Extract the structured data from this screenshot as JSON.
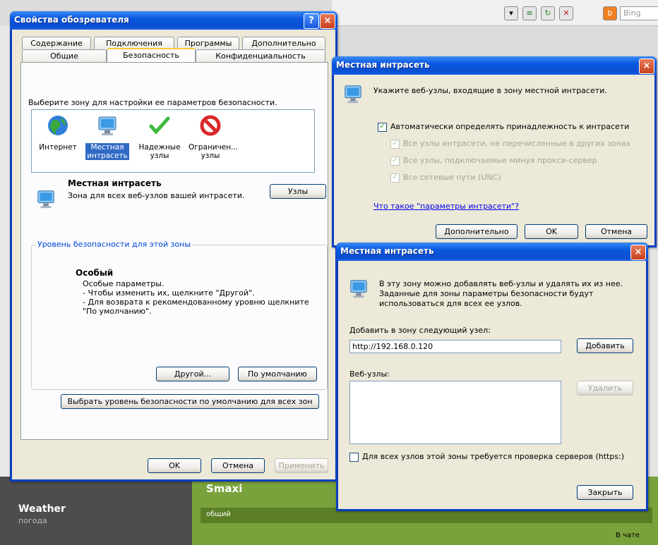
{
  "background": {
    "search_engine": "Bing",
    "weather_title": "Weather",
    "weather_sub": "погода",
    "smaxi": "Smaxi",
    "tab_general": "общий",
    "chat": "В чате"
  },
  "ie_options": {
    "title": "Свойства обозревателя",
    "help": "?",
    "close": "×",
    "tabs_row1": [
      "Содержание",
      "Подключения",
      "Программы",
      "Дополнительно"
    ],
    "tabs_row2": [
      "Общие",
      "Безопасность",
      "Конфиденциальность"
    ],
    "zone_prompt": "Выберите зону для настройки ее параметров безопасности.",
    "zones": [
      {
        "label": "Интернет",
        "icon": "globe-icon"
      },
      {
        "label": "Местная\nинтрасеть",
        "icon": "monitor-icon"
      },
      {
        "label": "Надежные\nузлы",
        "icon": "checkmark-icon"
      },
      {
        "label": "Ограничен...\nузлы",
        "icon": "restricted-icon"
      }
    ],
    "zone_name": "Местная интрасеть",
    "zone_desc": "Зона для всех веб-узлов вашей интрасети.",
    "sites_button": "Узлы",
    "level_group": "Уровень безопасности для этой зоны",
    "level_title": "Особый",
    "level_desc_1": "Особые параметры.",
    "level_desc_2": "- Чтобы изменить их, щелкните \"Другой\".",
    "level_desc_3": "- Для возврата к рекомендованному уровню щелкните",
    "level_desc_4": "\"По умолчанию\".",
    "other_button": "Другой...",
    "default_button": "По умолчанию",
    "reset_all_button": "Выбрать уровень безопасности по умолчанию для всех зон",
    "ok": "OK",
    "cancel": "Отмена",
    "apply": "Применить"
  },
  "intranet_dialog": {
    "title": "Местная интрасеть",
    "close": "×",
    "heading": "Укажите веб-узлы, входящие в зону местной интрасети.",
    "auto_detect": "Автоматически определять принадлежность к интрасети",
    "opt1": "Все узлы интрасети, не перечисленные в других зонах",
    "opt2": "Все узлы, подключаемые минуя прокси-сервер",
    "opt3": "Все сетевые пути (UNC)",
    "link": "Что такое \"параметры интрасети\"?",
    "advanced": "Дополнительно",
    "ok": "OK",
    "cancel": "Отмена"
  },
  "sites_dialog": {
    "title": "Местная интрасеть",
    "close": "×",
    "desc_1": "В эту зону можно добавлять веб-узлы и удалять их из нее.",
    "desc_2": "Заданные для зоны параметры безопасности будут",
    "desc_3": "использоваться для всех ее узлов.",
    "add_label": "Добавить в зону следующий узел:",
    "add_value": "http://192.168.0.120",
    "add_button": "Добавить",
    "sites_label": "Веб-узлы:",
    "remove_button": "Удалить",
    "https_check": "Для всех узлов этой зоны требуется проверка серверов (https:)",
    "close_button": "Закрыть"
  }
}
